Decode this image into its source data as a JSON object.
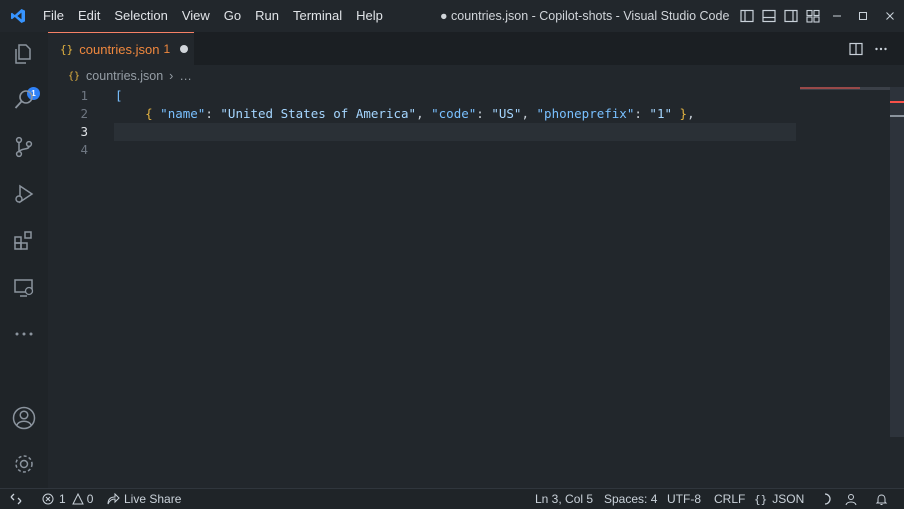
{
  "app": {
    "window_title": "● countries.json - Copilot-shots - Visual Studio Code",
    "logo_icon": "vscode-logo-icon",
    "accent_color": "#f78166",
    "badge_color": "#2f81f7"
  },
  "menu": {
    "items": [
      "File",
      "Edit",
      "Selection",
      "View",
      "Go",
      "Run",
      "Terminal",
      "Help"
    ]
  },
  "window_controls": [
    "toggle-primary-sidebar-icon",
    "toggle-panel-icon",
    "toggle-secondary-sidebar-icon",
    "customize-layout-icon",
    "minimize-icon",
    "maximize-icon",
    "close-icon"
  ],
  "activity_bar": {
    "items": [
      {
        "name": "explorer-icon",
        "badge": "1"
      },
      {
        "name": "search-icon"
      },
      {
        "name": "source-control-icon"
      },
      {
        "name": "run-debug-icon"
      },
      {
        "name": "extensions-icon"
      },
      {
        "name": "remote-explorer-icon"
      },
      {
        "name": "more-icon"
      }
    ],
    "bottom": [
      {
        "name": "accounts-icon"
      },
      {
        "name": "manage-gear-icon"
      }
    ]
  },
  "tab": {
    "icon": "{}",
    "label": "countries.json",
    "problem_count": "1",
    "dirty": true
  },
  "tab_actions": [
    "split-editor-icon",
    "more-actions-icon"
  ],
  "breadcrumb": {
    "icon": "{}",
    "file": "countries.json",
    "separator": "›",
    "more": "…"
  },
  "editor": {
    "line_numbers": [
      "1",
      "2",
      "3",
      "4"
    ],
    "active_line": "3",
    "lines": {
      "l1_bracket": "[",
      "l2_indent": "    ",
      "l2_open": "{",
      "l2_k1": "\"name\"",
      "l2_c1": ": ",
      "l2_v1": "\"United States of America\"",
      "l2_s1": ", ",
      "l2_k2": "\"code\"",
      "l2_c2": ": ",
      "l2_v2": "\"US\"",
      "l2_s2": ", ",
      "l2_k3": "\"phoneprefix\"",
      "l2_c3": ": ",
      "l2_v3": "\"1\"",
      "l2_close": " }",
      "l2_comma": ","
    }
  },
  "status_bar": {
    "remote_icon": "remote-icon",
    "errors": "1",
    "warnings": "0",
    "live_share": "Live Share",
    "cursor": "Ln 3, Col 5",
    "indent": "Spaces: 4",
    "encoding": "UTF-8",
    "eol": "CRLF",
    "language": "JSON",
    "language_icon": "{}"
  }
}
